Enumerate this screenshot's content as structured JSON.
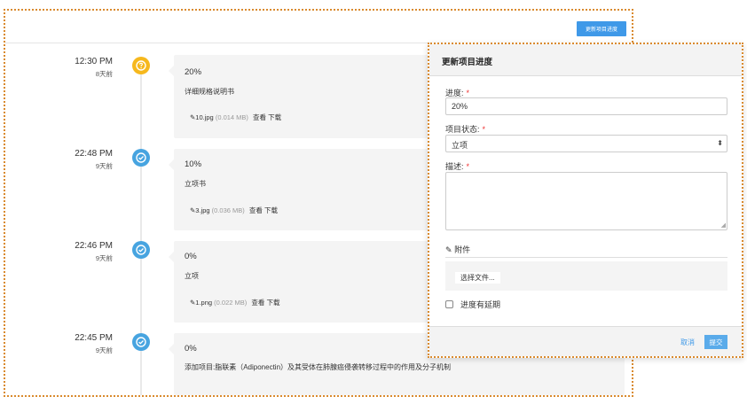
{
  "toolbar": {
    "update_label": "更新项目进度"
  },
  "entries": [
    {
      "time": "12:30 PM",
      "ago": "8天前",
      "status": "warn",
      "icon": "question-icon",
      "progress": "20%",
      "desc": "详细规格说明书",
      "file": {
        "name": "10.jpg",
        "size": "(0.014 MB)",
        "view": "查看",
        "download": "下载"
      }
    },
    {
      "time": "22:48 PM",
      "ago": "9天前",
      "status": "ok",
      "icon": "check-circle-icon",
      "progress": "10%",
      "desc": "立项书",
      "file": {
        "name": "3.jpg",
        "size": "(0.036 MB)",
        "view": "查看",
        "download": "下载"
      }
    },
    {
      "time": "22:46 PM",
      "ago": "9天前",
      "status": "ok",
      "icon": "check-circle-icon",
      "progress": "0%",
      "desc": "立项",
      "file": {
        "name": "1.png",
        "size": "(0.022 MB)",
        "view": "查看",
        "download": "下载"
      }
    },
    {
      "time": "22:45 PM",
      "ago": "9天前",
      "status": "ok",
      "icon": "check-circle-icon",
      "progress": "0%",
      "desc": "添加项目:脂联素（Adiponectin）及其受体在肺腺癌侵袭转移过程中的作用及分子机制"
    }
  ],
  "modal": {
    "title": "更新项目进度",
    "progress_label": "进度:",
    "progress_value": "20%",
    "status_label": "项目状态:",
    "status_value": "立项",
    "desc_label": "描述:",
    "required_mark": "*",
    "attach_label": "附件",
    "file_button": "选择文件...",
    "delay_label": "进度有延期",
    "cancel_label": "取消",
    "submit_label": "提交"
  },
  "colors": {
    "accent": "#3f99e8",
    "warn": "#f6b81d",
    "ok": "#47a4e0",
    "frame": "#d98a2e"
  }
}
